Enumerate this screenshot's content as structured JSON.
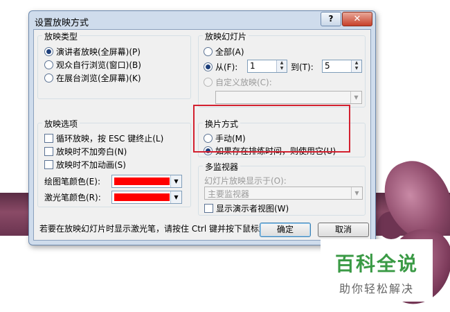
{
  "dialog": {
    "title": "设置放映方式",
    "help_label": "?",
    "close_label": "✕"
  },
  "show_type": {
    "legend": "放映类型",
    "options": [
      {
        "label": "演讲者放映(全屏幕)(P)",
        "selected": true
      },
      {
        "label": "观众自行浏览(窗口)(B)",
        "selected": false
      },
      {
        "label": "在展台浏览(全屏幕)(K)",
        "selected": false
      }
    ]
  },
  "slides": {
    "legend": "放映幻灯片",
    "all_label": "全部(A)",
    "from_label": "从(F):",
    "from_value": "1",
    "to_label": "到(T):",
    "to_value": "5",
    "custom_label": "自定义放映(C):",
    "custom_value": ""
  },
  "show_options": {
    "legend": "放映选项",
    "checks": [
      {
        "label": "循环放映，按 ESC 键终止(L)",
        "checked": false
      },
      {
        "label": "放映时不加旁白(N)",
        "checked": false
      },
      {
        "label": "放映时不加动画(S)",
        "checked": false
      }
    ],
    "pen_color_label": "绘图笔颜色(E):",
    "laser_color_label": "激光笔颜色(R):",
    "pen_color": "#ff0000",
    "laser_color": "#ff0000"
  },
  "advance": {
    "legend": "换片方式",
    "options": [
      {
        "label": "手动(M)",
        "selected": false
      },
      {
        "label": "如果存在排练时间，则使用它(U)",
        "selected": true
      }
    ]
  },
  "monitors": {
    "legend": "多监视器",
    "display_on_label": "幻灯片放映显示于(O):",
    "display_on_value": "主要监视器",
    "presenter_view_label": "显示演示者视图(W)"
  },
  "hint": "若要在放映幻灯片时显示激光笔，请按住 Ctrl 键并按下鼠标左按钮。",
  "buttons": {
    "ok": "确定",
    "cancel": "取消"
  },
  "watermark": {
    "title": "百科全说",
    "subtitle": "助你轻松解决"
  }
}
